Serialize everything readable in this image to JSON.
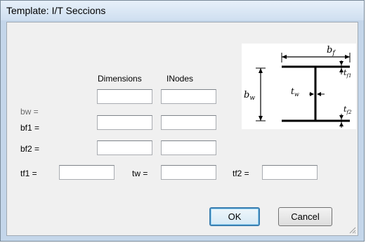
{
  "window": {
    "title": "Template: I/T Seccions"
  },
  "headers": {
    "dimensions": "Dimensions",
    "inodes": "INodes"
  },
  "rows": [
    {
      "label": "bw ="
    },
    {
      "label": "bf1 ="
    },
    {
      "label": "bf2 ="
    }
  ],
  "thickness": {
    "tf1_label": "tf1 =",
    "tw_label": "tw =",
    "tf2_label": "tf2 ="
  },
  "diagram": {
    "bf": "b",
    "bf_sub": "f",
    "bw": "b",
    "bw_sub": "w",
    "tw": "t",
    "tw_sub": "w",
    "tf1": "t",
    "tf1_sub": "f1",
    "tf2": "t",
    "tf2_sub": "f2"
  },
  "buttons": {
    "ok": "OK",
    "cancel": "Cancel"
  },
  "icons": {
    "resize_grip": "resize-grip-icon"
  }
}
